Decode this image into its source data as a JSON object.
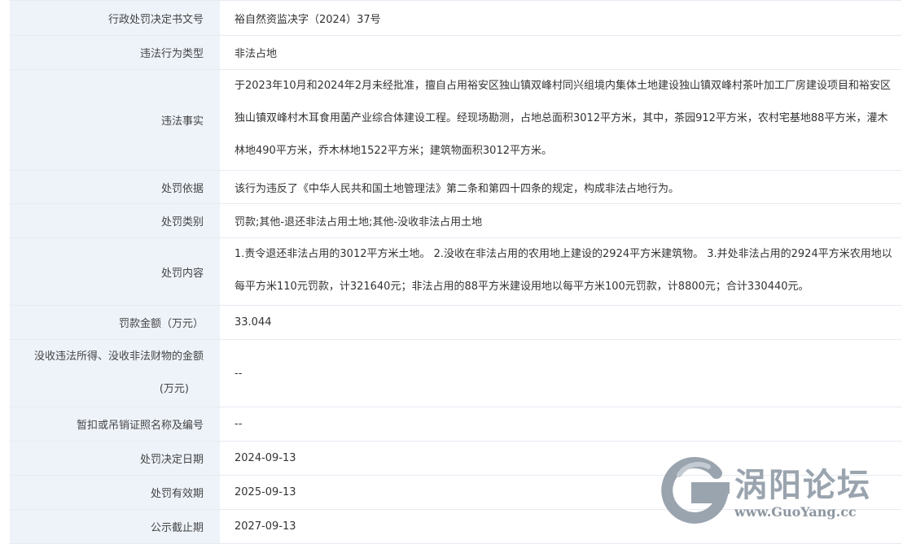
{
  "rows": [
    {
      "label": "行政处罚决定书文号",
      "value": "裕自然资监决字（2024）37号"
    },
    {
      "label": "违法行为类型",
      "value": "非法占地"
    },
    {
      "label": "违法事实",
      "value": "于2023年10月和2024年2月未经批准，擅自占用裕安区独山镇双峰村同兴组境内集体土地建设独山镇双峰村茶叶加工厂房建设项目和裕安区独山镇双峰村木耳食用菌产业综合体建设工程。经现场勘测，占地总面积3012平方米，其中，茶园912平方米，农村宅基地88平方米，灌木林地490平方米，乔木林地1522平方米；建筑物面积3012平方米。"
    },
    {
      "label": "处罚依据",
      "value": "该行为违反了《中华人民共和国土地管理法》第二条和第四十四条的规定，构成非法占地行为。"
    },
    {
      "label": "处罚类别",
      "value": "罚款;其他-退还非法占用土地;其他-没收非法占用土地"
    },
    {
      "label": "处罚内容",
      "value": "1.责令退还非法占用的3012平方米土地。 2.没收在非法占用的农用地上建设的2924平方米建筑物。 3.并处非法占用的2924平方米农用地以每平方米110元罚款，计321640元；非法占用的88平方米建设用地以每平方米100元罚款，计8800元；合计330440元。"
    },
    {
      "label": "罚款金额（万元）",
      "value": "33.044"
    },
    {
      "label_lines": [
        "没收违法所得、没收非法财物的金额",
        "(万元)"
      ],
      "value": "--"
    },
    {
      "label": "暂扣或吊销证照名称及编号",
      "value": "--"
    },
    {
      "label": "处罚决定日期",
      "value": "2024-09-13"
    },
    {
      "label": "处罚有效期",
      "value": "2025-09-13"
    },
    {
      "label": "公示截止期",
      "value": "2027-09-13"
    }
  ],
  "watermark": {
    "name": "涡阳论坛",
    "url": "www.GuoYang.cc"
  }
}
